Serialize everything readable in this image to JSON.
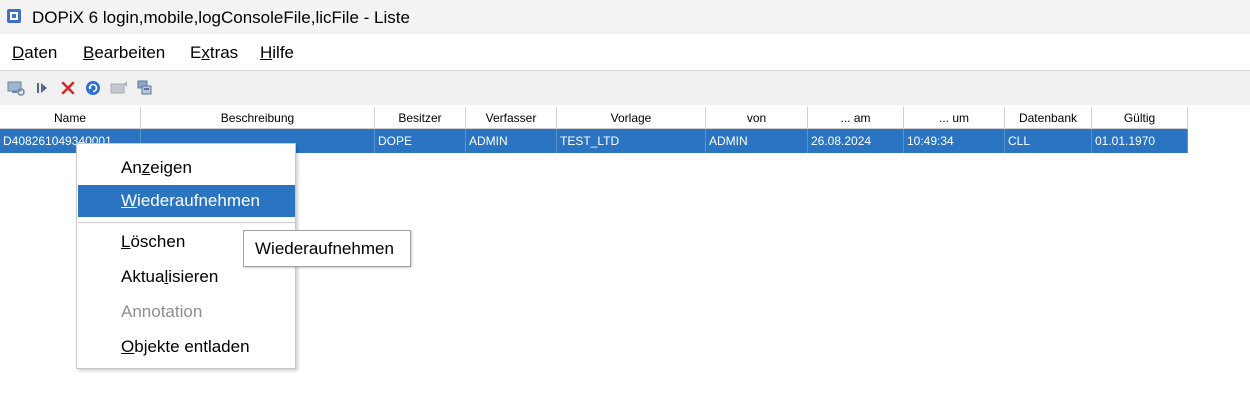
{
  "window": {
    "title": "DOPiX 6 login,mobile,logConsoleFile,licFile -  Liste"
  },
  "menu": [
    {
      "label": "Daten",
      "mnemonic_index": 0
    },
    {
      "label": "Bearbeiten",
      "mnemonic_index": 0
    },
    {
      "label": "Extras",
      "mnemonic_index": 1
    },
    {
      "label": "Hilfe",
      "mnemonic_index": 0
    }
  ],
  "toolbar": {
    "icons": [
      "view-icon",
      "resume-icon",
      "delete-icon",
      "refresh-icon",
      "annotation-icon",
      "unload-icon"
    ]
  },
  "table": {
    "columns": [
      "Name",
      "Beschreibung",
      "Besitzer",
      "Verfasser",
      "Vorlage",
      "von",
      "... am",
      "... um",
      "Datenbank",
      "Gültig"
    ],
    "rows": [
      [
        "D408261049340001",
        "",
        "DOPE",
        "ADMIN",
        "TEST_LTD",
        "ADMIN",
        "26.08.2024",
        "10:49:34",
        "CLL",
        "01.01.1970"
      ]
    ]
  },
  "context_menu": {
    "items": [
      {
        "label": "Anzeigen",
        "mnemonic_index": 2,
        "state": "normal"
      },
      {
        "label": "Wiederaufnehmen",
        "mnemonic_index": 0,
        "state": "selected"
      },
      {
        "label": "Löschen",
        "mnemonic_index": 0,
        "state": "normal"
      },
      {
        "label": "Aktualisieren",
        "mnemonic_index": 5,
        "state": "normal"
      },
      {
        "label": "Annotation",
        "mnemonic_index": -1,
        "state": "disabled"
      },
      {
        "label": "Objekte entladen",
        "mnemonic_index": 0,
        "state": "normal"
      }
    ]
  },
  "tooltip": {
    "text": "Wiederaufnehmen"
  },
  "colors": {
    "selection": "#2a74c2",
    "titlebar": "#f3f3f3",
    "toolbar": "#f0f0f0"
  }
}
